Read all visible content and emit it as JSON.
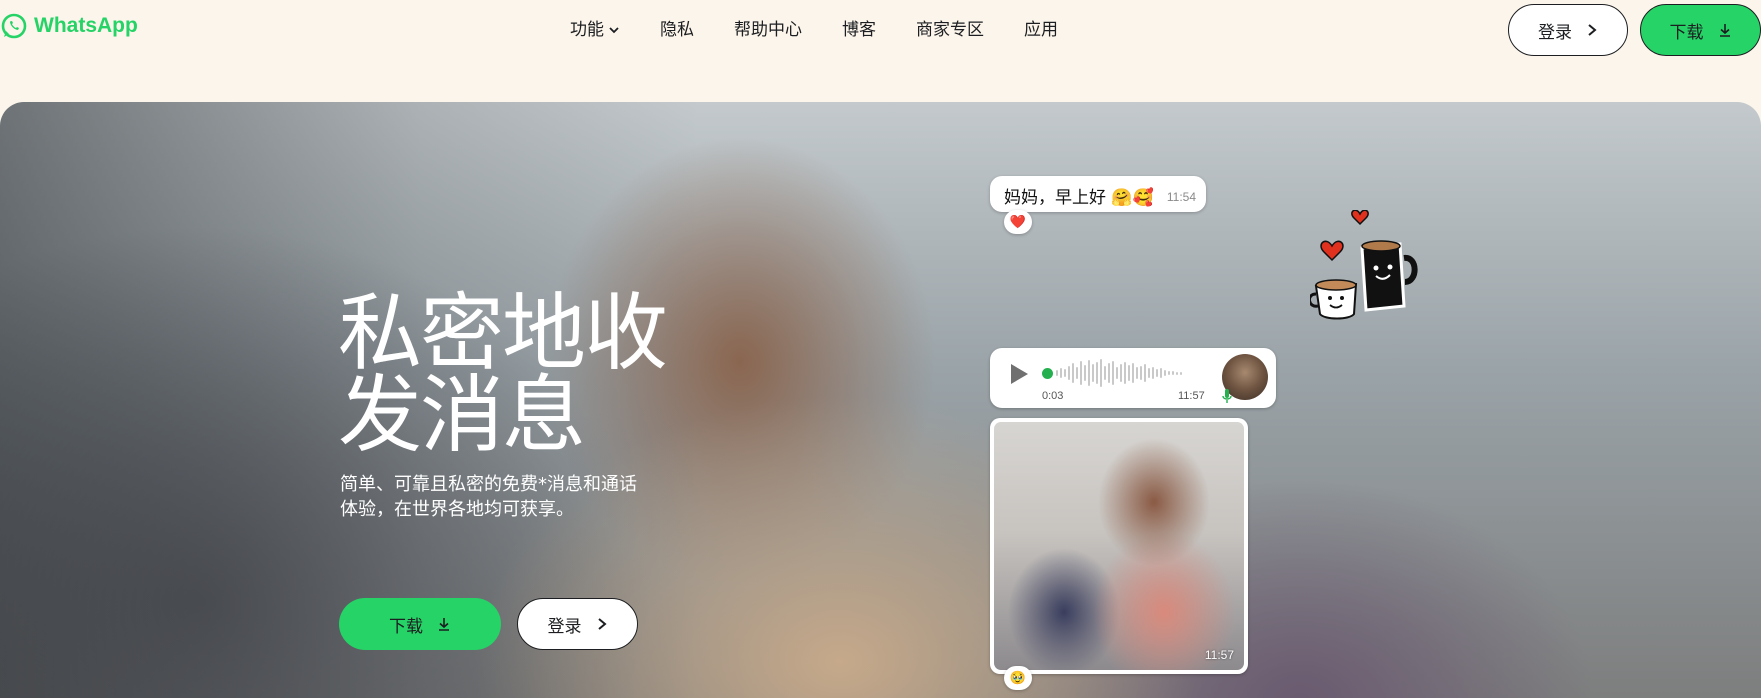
{
  "brand": {
    "name": "WhatsApp",
    "color": "#25d366",
    "icon": "whatsapp-logo-icon"
  },
  "nav": [
    {
      "label": "功能",
      "has_dropdown": true
    },
    {
      "label": "隐私"
    },
    {
      "label": "帮助中心"
    },
    {
      "label": "博客"
    },
    {
      "label": "商家专区"
    },
    {
      "label": "应用"
    }
  ],
  "header_actions": {
    "login_label": "登录",
    "download_label": "下载"
  },
  "hero": {
    "title_line1": "私密地收",
    "title_line2": "发消息",
    "subtitle_line1": "简单、可靠且私密的免费*消息和通话",
    "subtitle_line2": "体验，在世界各地均可获享。",
    "download_label": "下载",
    "login_label": "登录"
  },
  "chat": {
    "text_message": "妈妈，早上好 🤗🥰",
    "text_time": "11:54",
    "text_reaction": "❤️",
    "voice_duration": "0:03",
    "voice_time": "11:57",
    "photo_time": "11:57",
    "photo_reaction": "🥹"
  }
}
